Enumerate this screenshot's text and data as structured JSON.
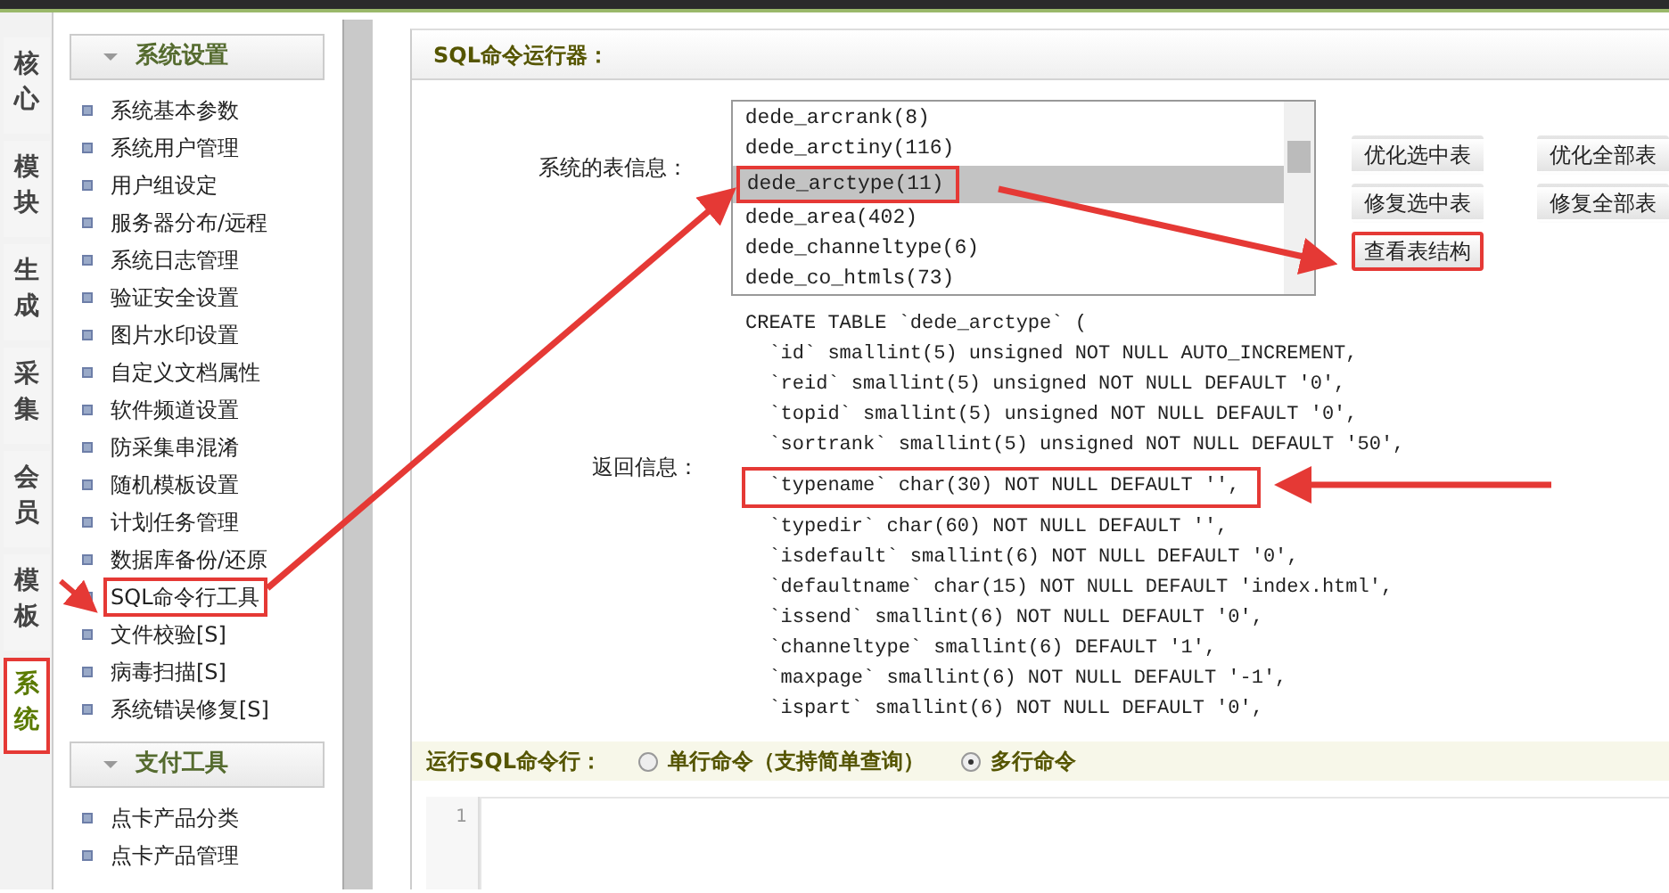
{
  "side_tabs": [
    {
      "label": "核心",
      "selected": false,
      "highlighted": false
    },
    {
      "label": "模块",
      "selected": false,
      "highlighted": false
    },
    {
      "label": "生成",
      "selected": false,
      "highlighted": false
    },
    {
      "label": "采集",
      "selected": false,
      "highlighted": false
    },
    {
      "label": "会员",
      "selected": false,
      "highlighted": false
    },
    {
      "label": "模板",
      "selected": false,
      "highlighted": false
    },
    {
      "label": "系统",
      "selected": true,
      "highlighted": true
    }
  ],
  "sidebar": {
    "groups": [
      {
        "title": "系统设置",
        "items": [
          {
            "label": "系统基本参数",
            "highlighted": false
          },
          {
            "label": "系统用户管理",
            "highlighted": false
          },
          {
            "label": "用户组设定",
            "highlighted": false
          },
          {
            "label": "服务器分布/远程",
            "highlighted": false
          },
          {
            "label": "系统日志管理",
            "highlighted": false
          },
          {
            "label": "验证安全设置",
            "highlighted": false
          },
          {
            "label": "图片水印设置",
            "highlighted": false
          },
          {
            "label": "自定义文档属性",
            "highlighted": false
          },
          {
            "label": "软件频道设置",
            "highlighted": false
          },
          {
            "label": "防采集串混淆",
            "highlighted": false
          },
          {
            "label": "随机模板设置",
            "highlighted": false
          },
          {
            "label": "计划任务管理",
            "highlighted": false
          },
          {
            "label": "数据库备份/还原",
            "highlighted": false
          },
          {
            "label": "SQL命令行工具",
            "highlighted": true
          },
          {
            "label": "文件校验[S]",
            "highlighted": false
          },
          {
            "label": "病毒扫描[S]",
            "highlighted": false
          },
          {
            "label": "系统错误修复[S]",
            "highlighted": false
          }
        ]
      },
      {
        "title": "支付工具",
        "items": [
          {
            "label": "点卡产品分类",
            "highlighted": false
          },
          {
            "label": "点卡产品管理",
            "highlighted": false
          }
        ]
      }
    ]
  },
  "panel": {
    "title": "SQL命令运行器：",
    "tables_label": "系统的表信息：",
    "tables": [
      {
        "label": "dede_arcrank(8)",
        "selected": false,
        "highlighted": false
      },
      {
        "label": "dede_arctiny(116)",
        "selected": false,
        "highlighted": false
      },
      {
        "label": "dede_arctype(11)",
        "selected": true,
        "highlighted": true
      },
      {
        "label": "dede_area(402)",
        "selected": false,
        "highlighted": false
      },
      {
        "label": "dede_channeltype(6)",
        "selected": false,
        "highlighted": false
      },
      {
        "label": "dede_co_htmls(73)",
        "selected": false,
        "highlighted": false
      }
    ],
    "buttons": [
      [
        {
          "label": "优化选中表",
          "highlighted": false
        },
        {
          "label": "优化全部表",
          "highlighted": false
        }
      ],
      [
        {
          "label": "修复选中表",
          "highlighted": false
        },
        {
          "label": "修复全部表",
          "highlighted": false
        }
      ],
      [
        {
          "label": "查看表结构",
          "highlighted": true
        }
      ]
    ],
    "result_label": "返回信息：",
    "result_lines": [
      {
        "text": "CREATE TABLE `dede_arctype` (",
        "highlighted": false
      },
      {
        "text": "  `id` smallint(5) unsigned NOT NULL AUTO_INCREMENT,",
        "highlighted": false
      },
      {
        "text": "  `reid` smallint(5) unsigned NOT NULL DEFAULT '0',",
        "highlighted": false
      },
      {
        "text": "  `topid` smallint(5) unsigned NOT NULL DEFAULT '0',",
        "highlighted": false
      },
      {
        "text": "  `sortrank` smallint(5) unsigned NOT NULL DEFAULT '50',",
        "highlighted": false
      },
      {
        "text": "  `typename` char(30) NOT NULL DEFAULT '',",
        "highlighted": true
      },
      {
        "text": "  `typedir` char(60) NOT NULL DEFAULT '',",
        "highlighted": false
      },
      {
        "text": "  `isdefault` smallint(6) NOT NULL DEFAULT '0',",
        "highlighted": false
      },
      {
        "text": "  `defaultname` char(15) NOT NULL DEFAULT 'index.html',",
        "highlighted": false
      },
      {
        "text": "  `issend` smallint(6) NOT NULL DEFAULT '0',",
        "highlighted": false
      },
      {
        "text": "  `channeltype` smallint(6) DEFAULT '1',",
        "highlighted": false
      },
      {
        "text": "  `maxpage` smallint(6) NOT NULL DEFAULT '-1',",
        "highlighted": false
      },
      {
        "text": "  `ispart` smallint(6) NOT NULL DEFAULT '0',",
        "highlighted": false
      }
    ],
    "run_label": "运行SQL命令行：",
    "modes": [
      {
        "label": "单行命令（支持简单查询）",
        "selected": false
      },
      {
        "label": "多行命令",
        "selected": true
      }
    ],
    "editor": {
      "line_numbers": [
        "1"
      ]
    }
  }
}
